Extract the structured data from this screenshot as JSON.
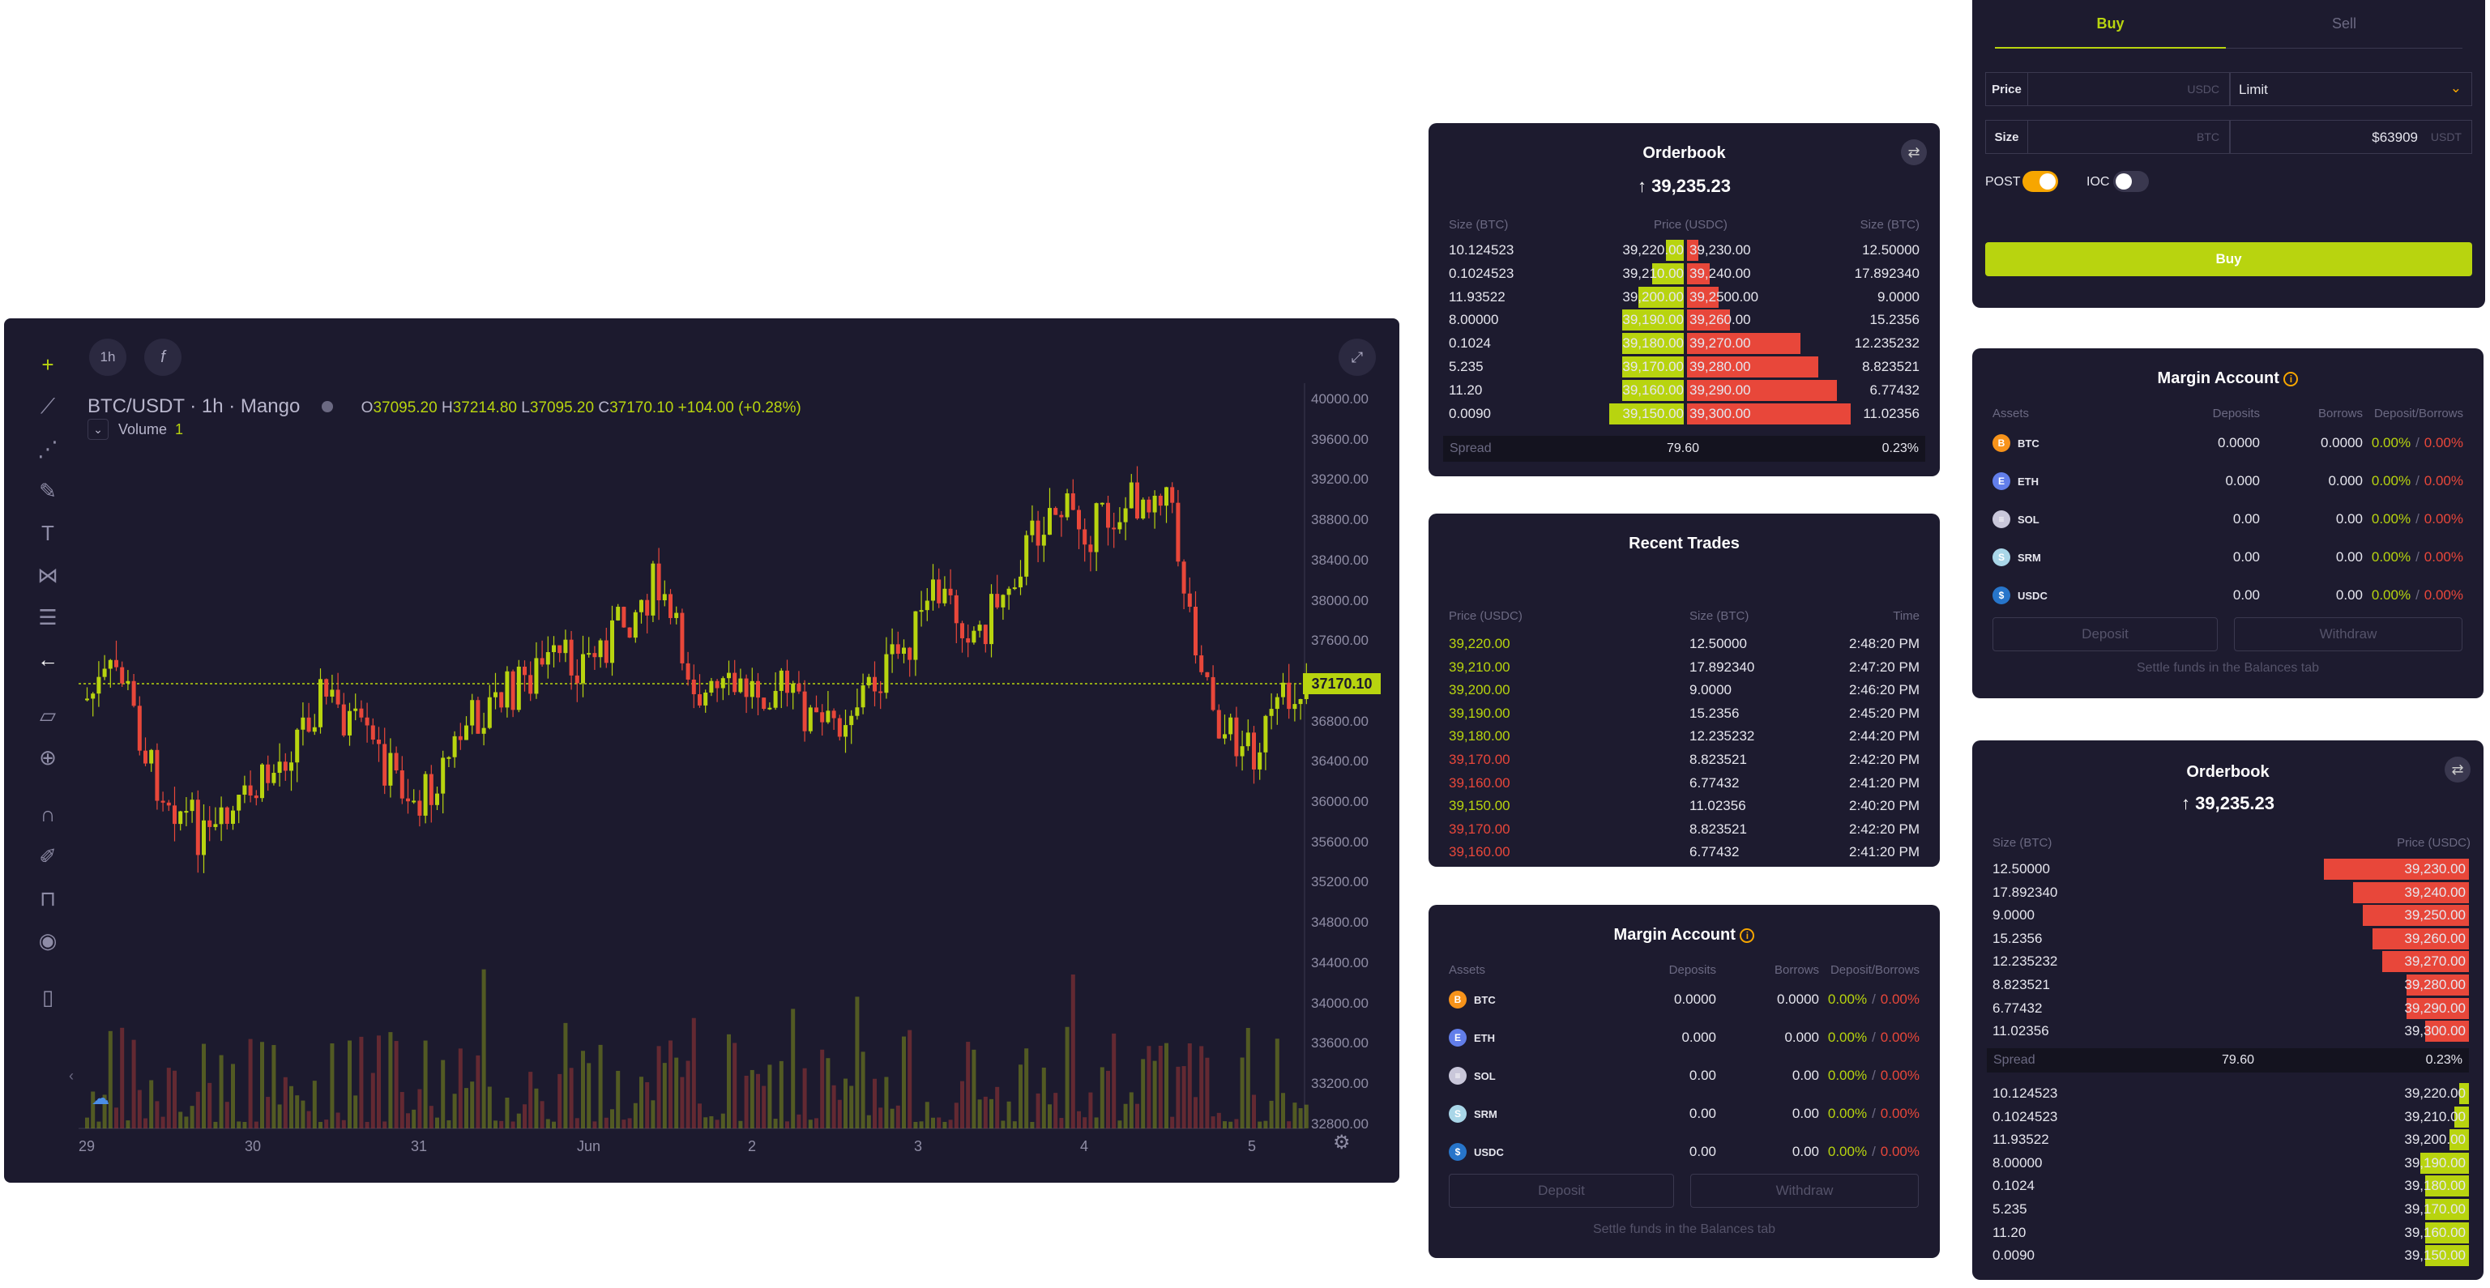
{
  "chart": {
    "interval_chip": "1h",
    "fx_chip": "f",
    "symbol": "BTC/USDT · 1h · Mango",
    "ohlc": {
      "o_label": "O",
      "o": "37095.20",
      "h_label": "H",
      "h": "37214.80",
      "l_label": "L",
      "l": "37095.20",
      "c_label": "C",
      "c": "37170.10",
      "change": "+104.00 (+0.28%)"
    },
    "volume_label": "Volume",
    "volume_value": "1",
    "current_price": "37170.10",
    "y_ticks": [
      "40000.00",
      "39600.00",
      "39200.00",
      "38800.00",
      "38400.00",
      "38000.00",
      "37600.00",
      "37200.00",
      "36800.00",
      "36400.00",
      "36000.00",
      "35600.00",
      "35200.00",
      "34800.00",
      "34400.00",
      "34000.00",
      "33600.00",
      "33200.00",
      "32800.00"
    ],
    "x_ticks": [
      "29",
      "30",
      "31",
      "Jun",
      "2",
      "3",
      "4",
      "5"
    ],
    "colors": {
      "up": "#b8d40f",
      "down": "#e8473a",
      "background": "#1c1a2e"
    }
  },
  "orderbook1": {
    "title": "Orderbook",
    "last_price": "39,235.23",
    "headers": {
      "size_left": "Size (BTC)",
      "price": "Price (USDC)",
      "size_right": "Size (BTC)"
    },
    "bids": [
      {
        "size": "10.124523",
        "price": "39,220.00",
        "depth": 0.08
      },
      {
        "size": "0.1024523",
        "price": "39,210.00",
        "depth": 0.14
      },
      {
        "size": "11.93522",
        "price": "39,200.00",
        "depth": 0.2
      },
      {
        "size": "8.00000",
        "price": "39,190.00",
        "depth": 0.27
      },
      {
        "size": "0.1024",
        "price": "39,180.00",
        "depth": 0.27
      },
      {
        "size": "5.235",
        "price": "39,170.00",
        "depth": 0.27
      },
      {
        "size": "11.20",
        "price": "39,160.00",
        "depth": 0.27
      },
      {
        "size": "0.0090",
        "price": "39,150.00",
        "depth": 0.33
      }
    ],
    "asks": [
      {
        "price": "39,230.00",
        "size": "12.50000",
        "depth": 0.05
      },
      {
        "price": "39,240.00",
        "size": "17.892340",
        "depth": 0.1
      },
      {
        "price": "39,2500.00",
        "size": "9.0000",
        "depth": 0.14
      },
      {
        "price": "39,260.00",
        "size": "15.2356",
        "depth": 0.19
      },
      {
        "price": "39,270.00",
        "size": "12.235232",
        "depth": 0.5
      },
      {
        "price": "39,280.00",
        "size": "8.823521",
        "depth": 0.58
      },
      {
        "price": "39,290.00",
        "size": "6.77432",
        "depth": 0.66
      },
      {
        "price": "39,300.00",
        "size": "11.02356",
        "depth": 0.72
      }
    ],
    "spread_label": "Spread",
    "spread_value": "79.60",
    "spread_pct": "0.23%"
  },
  "recent_trades": {
    "title": "Recent Trades",
    "headers": {
      "price": "Price (USDC)",
      "size": "Size (BTC)",
      "time": "Time"
    },
    "rows": [
      {
        "price": "39,220.00",
        "size": "12.50000",
        "time": "2:48:20 PM",
        "side": "buy"
      },
      {
        "price": "39,210.00",
        "size": "17.892340",
        "time": "2:47:20 PM",
        "side": "buy"
      },
      {
        "price": "39,200.00",
        "size": "9.0000",
        "time": "2:46:20 PM",
        "side": "buy"
      },
      {
        "price": "39,190.00",
        "size": "15.2356",
        "time": "2:45:20 PM",
        "side": "buy"
      },
      {
        "price": "39,180.00",
        "size": "12.235232",
        "time": "2:44:20 PM",
        "side": "buy"
      },
      {
        "price": "39,170.00",
        "size": "8.823521",
        "time": "2:42:20 PM",
        "side": "sell"
      },
      {
        "price": "39,160.00",
        "size": "6.77432",
        "time": "2:41:20 PM",
        "side": "sell"
      },
      {
        "price": "39,150.00",
        "size": "11.02356",
        "time": "2:40:20 PM",
        "side": "buy"
      },
      {
        "price": "39,170.00",
        "size": "8.823521",
        "time": "2:42:20 PM",
        "side": "sell"
      },
      {
        "price": "39,160.00",
        "size": "6.77432",
        "time": "2:41:20 PM",
        "side": "sell"
      }
    ]
  },
  "margin": {
    "title": "Margin Account",
    "headers": {
      "assets": "Assets",
      "deposits": "Deposits",
      "borrows": "Borrows",
      "rates": "Deposit/Borrows"
    },
    "rows": [
      {
        "asset": "BTC",
        "deposits": "0.0000",
        "borrows": "0.0000",
        "dep_rate": "0.00%",
        "bor_rate": "0.00%",
        "color": "#f7931a",
        "glyph": "B"
      },
      {
        "asset": "ETH",
        "deposits": "0.000",
        "borrows": "0.000",
        "dep_rate": "0.00%",
        "bor_rate": "0.00%",
        "color": "#627eea",
        "glyph": "E"
      },
      {
        "asset": "SOL",
        "deposits": "0.00",
        "borrows": "0.00",
        "dep_rate": "0.00%",
        "bor_rate": "0.00%",
        "color": "#c9c7da",
        "glyph": "≡"
      },
      {
        "asset": "SRM",
        "deposits": "0.00",
        "borrows": "0.00",
        "dep_rate": "0.00%",
        "bor_rate": "0.00%",
        "color": "#a9d6e8",
        "glyph": "S"
      },
      {
        "asset": "USDC",
        "deposits": "0.00",
        "borrows": "0.00",
        "dep_rate": "0.00%",
        "bor_rate": "0.00%",
        "color": "#2775ca",
        "glyph": "$"
      }
    ],
    "slash": "/",
    "deposit_button": "Deposit",
    "withdraw_button": "Withdraw",
    "footer": "Settle funds in the Balances tab"
  },
  "trade_form": {
    "tab_buy": "Buy",
    "tab_sell": "Sell",
    "price_label": "Price",
    "price_unit": "USDC",
    "order_type": "Limit",
    "size_label": "Size",
    "size_unit": "BTC",
    "size_usdt_value": "$63909",
    "size_usdt_unit": "USDT",
    "post_label": "POST",
    "post_on": true,
    "ioc_label": "IOC",
    "ioc_on": false,
    "submit": "Buy"
  },
  "orderbook2": {
    "title": "Orderbook",
    "last_price": "39,235.23",
    "headers": {
      "size": "Size (BTC)",
      "price": "Price (USDC)"
    },
    "asks": [
      {
        "size": "12.50000",
        "price": "39,230.00",
        "depth": 0.3
      },
      {
        "size": "17.892340",
        "price": "39,240.00",
        "depth": 0.24
      },
      {
        "size": "9.0000",
        "price": "39,250.00",
        "depth": 0.22
      },
      {
        "size": "15.2356",
        "price": "39,260.00",
        "depth": 0.2
      },
      {
        "size": "12.235232",
        "price": "39,270.00",
        "depth": 0.18
      },
      {
        "size": "8.823521",
        "price": "39,280.00",
        "depth": 0.13
      },
      {
        "size": "6.77432",
        "price": "39,290.00",
        "depth": 0.13
      },
      {
        "size": "11.02356",
        "price": "39,300.00",
        "depth": 0.09
      }
    ],
    "spread_label": "Spread",
    "spread_value": "79.60",
    "spread_pct": "0.23%",
    "bids": [
      {
        "size": "10.124523",
        "price": "39,220.00",
        "depth": 0.02
      },
      {
        "size": "0.1024523",
        "price": "39,210.00",
        "depth": 0.03
      },
      {
        "size": "11.93522",
        "price": "39,200.00",
        "depth": 0.04
      },
      {
        "size": "8.00000",
        "price": "39,190.00",
        "depth": 0.1
      },
      {
        "size": "0.1024",
        "price": "39,180.00",
        "depth": 0.09
      },
      {
        "size": "5.235",
        "price": "39,170.00",
        "depth": 0.09
      },
      {
        "size": "11.20",
        "price": "39,160.00",
        "depth": 0.09
      },
      {
        "size": "0.0090",
        "price": "39,150.00",
        "depth": 0.09
      }
    ]
  }
}
